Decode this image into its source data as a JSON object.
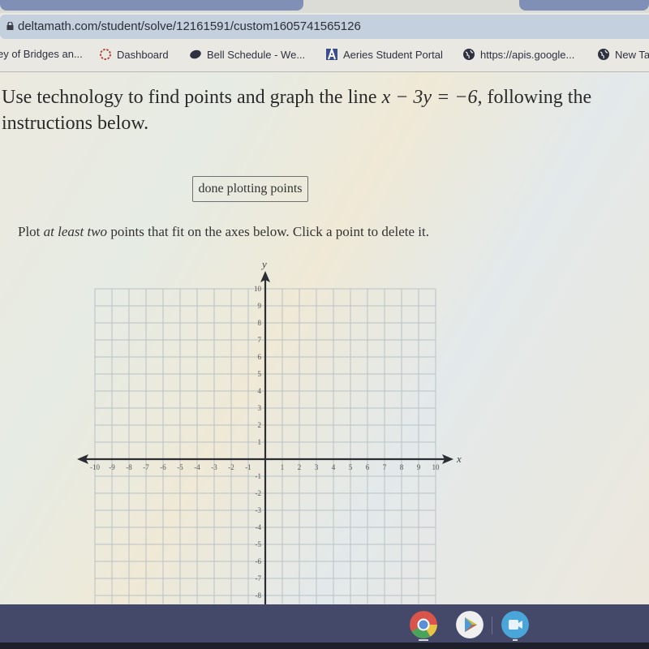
{
  "browser": {
    "url": "deltamath.com/student/solve/12161591/custom1605741565126",
    "bookmarks": [
      {
        "label": "ey of Bridges an...",
        "icon": "none"
      },
      {
        "label": "Dashboard",
        "icon": "canvas-icon"
      },
      {
        "label": "Bell Schedule - We...",
        "icon": "blob-icon"
      },
      {
        "label": "Aeries Student Portal",
        "icon": "aeries-icon"
      },
      {
        "label": "https://apis.google...",
        "icon": "globe-icon"
      },
      {
        "label": "New Ta",
        "icon": "globe-icon"
      }
    ]
  },
  "question": {
    "prefix": "Use technology to find points and graph the line ",
    "equation": "x − 3y = −6",
    "suffix": ", following the",
    "line2": "instructions below."
  },
  "done_button": {
    "label": "done plotting points"
  },
  "instructions": {
    "part1": "Plot ",
    "emphasis": "at least two",
    "part2": " points that fit on the axes below. Click a point to delete it."
  },
  "chart_data": {
    "type": "scatter",
    "title": "",
    "xlabel": "x",
    "ylabel": "y",
    "xlim": [
      -10,
      10
    ],
    "ylim_visible": [
      -8,
      10
    ],
    "grid": true,
    "x_ticks": [
      -10,
      -9,
      -8,
      -7,
      -6,
      -5,
      -4,
      -3,
      -2,
      -1,
      1,
      2,
      3,
      4,
      5,
      6,
      7,
      8,
      9,
      10
    ],
    "y_ticks": [
      10,
      9,
      8,
      7,
      6,
      5,
      4,
      3,
      2,
      1,
      -1,
      -2,
      -3,
      -4,
      -5,
      -6,
      -7,
      -8
    ],
    "points": []
  },
  "shelf": {
    "apps": [
      {
        "name": "Chrome",
        "icon": "chrome-icon",
        "active": true
      },
      {
        "name": "Play Store",
        "icon": "play-store-icon",
        "active": false
      },
      {
        "name": "Meet",
        "icon": "video-camera-icon",
        "active": true
      }
    ]
  }
}
